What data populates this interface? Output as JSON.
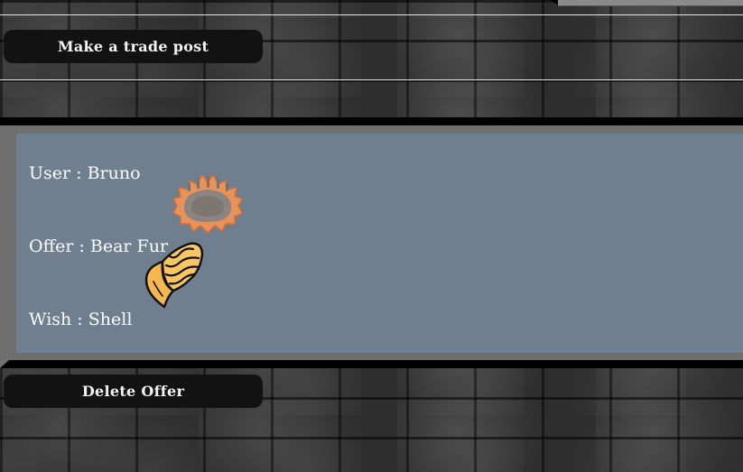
{
  "toolbar": {
    "make_post_label": "Make a trade post"
  },
  "trade": {
    "user_label": "User : Bruno",
    "offer_label": "Offer : Bear Fur",
    "wish_label": "Wish : Shell",
    "offer_icon": "bear-fur-icon",
    "wish_icon": "shell-icon"
  },
  "actions": {
    "delete_label": "Delete Offer"
  },
  "colors": {
    "card_background": "#707f8f",
    "button_background": "#121212",
    "fur_orange": "#e8925a",
    "shell_yellow": "#f6b84e"
  }
}
